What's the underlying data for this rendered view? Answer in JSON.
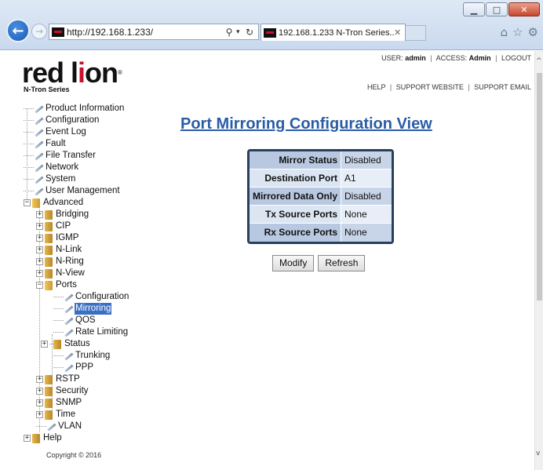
{
  "browser": {
    "url": "http://192.168.1.233/",
    "tab_title": "192.168.1.233 N-Tron Series...",
    "back_icon": "back-arrow-icon",
    "forward_icon": "forward-arrow-icon",
    "search_glyph": "⚲",
    "dropdown_glyph": "▾",
    "refresh_glyph": "↻",
    "tab_close_glyph": "✕",
    "window_min": "▁",
    "window_max": "□",
    "window_close": "✕",
    "home_glyph": "⌂",
    "star_glyph": "☆",
    "gear_glyph": "⚙"
  },
  "logo": {
    "text_before": "red l",
    "text_o": "i",
    "text_after": "on",
    "registered": "®",
    "subtitle": "N-Tron Series"
  },
  "header": {
    "user_label": "USER:",
    "user_value": "admin",
    "access_label": "ACCESS:",
    "access_value": "Admin",
    "logout": "LOGOUT",
    "help": "HELP",
    "support_website": "SUPPORT WEBSITE",
    "support_email": "SUPPORT EMAIL",
    "separator": "|"
  },
  "tree": {
    "product_information": "Product Information",
    "configuration": "Configuration",
    "event_log": "Event Log",
    "fault": "Fault",
    "file_transfer": "File Transfer",
    "network": "Network",
    "system": "System",
    "user_management": "User Management",
    "advanced": "Advanced",
    "bridging": "Bridging",
    "cip": "CIP",
    "igmp": "IGMP",
    "n_link": "N-Link",
    "n_ring": "N-Ring",
    "n_view": "N-View",
    "ports": "Ports",
    "ports_configuration": "Configuration",
    "ports_mirroring": "Mirroring",
    "ports_qos": "QOS",
    "ports_rate_limiting": "Rate Limiting",
    "ports_status": "Status",
    "ports_trunking": "Trunking",
    "ports_ppp": "PPP",
    "rstp": "RSTP",
    "security": "Security",
    "snmp": "SNMP",
    "time": "Time",
    "vlan": "VLAN",
    "help": "Help",
    "plus": "+",
    "minus": "−"
  },
  "main": {
    "title": "Port Mirroring Configuration View",
    "rows": [
      {
        "label": "Mirror Status",
        "value": "Disabled"
      },
      {
        "label": "Destination Port",
        "value": "A1"
      },
      {
        "label": "Mirrored Data Only",
        "value": "Disabled"
      },
      {
        "label": "Tx Source Ports",
        "value": "None"
      },
      {
        "label": "Rx Source Ports",
        "value": "None"
      }
    ],
    "modify_label": "Modify",
    "refresh_label": "Refresh"
  },
  "footer": {
    "copyright": "Copyright © 2016"
  },
  "scrollbar": {
    "up_glyph": "^",
    "down_glyph": "v"
  }
}
